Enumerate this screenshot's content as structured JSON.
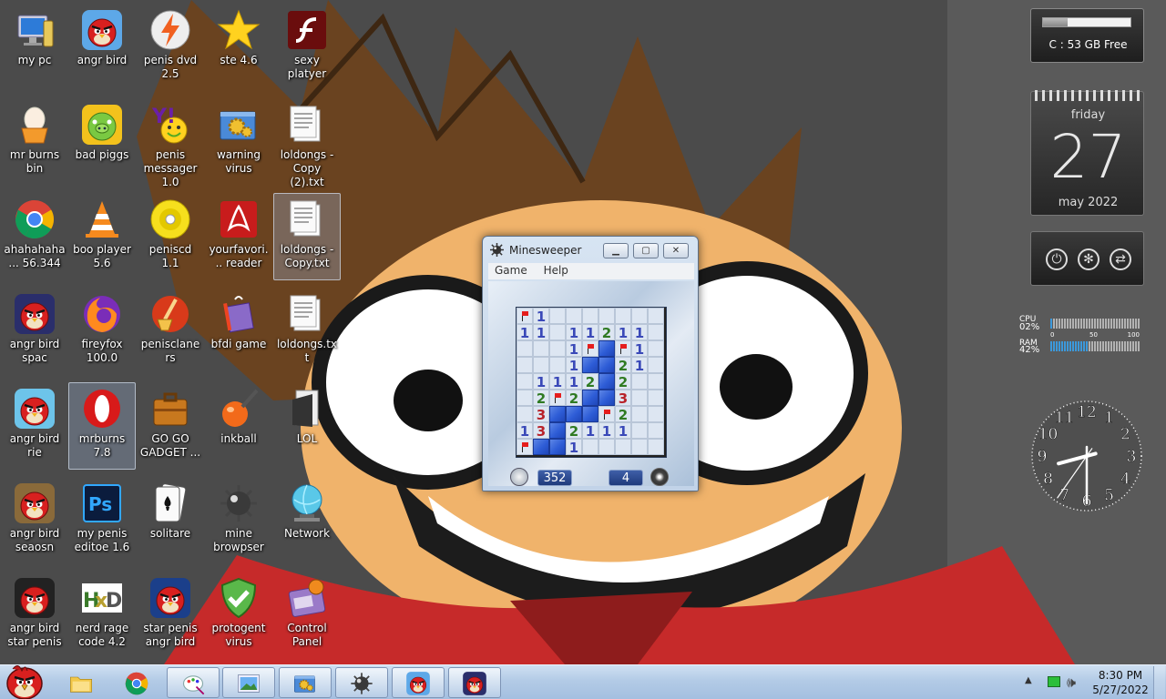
{
  "desktop": {
    "icons": [
      {
        "label": "my pc",
        "icon": "computer-icon"
      },
      {
        "label": "angr bird",
        "icon": "angry-bird-icon"
      },
      {
        "label": "penis dvd 2.5",
        "icon": "lightning-disc-icon"
      },
      {
        "label": "ste 4.6",
        "icon": "star-icon"
      },
      {
        "label": "sexy platyer",
        "icon": "flash-player-icon"
      },
      {
        "label": "mr burns bin",
        "icon": "egg-bin-icon"
      },
      {
        "label": "bad piggs",
        "icon": "bad-piggies-icon"
      },
      {
        "label": "penis messager 1.0",
        "icon": "yahoo-messenger-icon"
      },
      {
        "label": "warning virus",
        "icon": "gears-window-icon"
      },
      {
        "label": "loldongs - Copy (2).txt",
        "icon": "text-file-icon"
      },
      {
        "label": "ahahahaha... 56.344",
        "icon": "chrome-icon"
      },
      {
        "label": "boo player 5.6",
        "icon": "vlc-cone-icon"
      },
      {
        "label": "peniscd 1.1",
        "icon": "cd-icon"
      },
      {
        "label": "yourfavori... reader",
        "icon": "pdf-reader-icon"
      },
      {
        "label": "loldongs - Copy.txt",
        "icon": "text-file-icon"
      },
      {
        "label": "angr  bird spac",
        "icon": "angry-bird-space-icon"
      },
      {
        "label": "fireyfox 100.0",
        "icon": "firefox-icon"
      },
      {
        "label": "penisclaners",
        "icon": "broom-icon"
      },
      {
        "label": "bfdi game",
        "icon": "gift-box-icon"
      },
      {
        "label": "loldongs.txt",
        "icon": "text-file-icon"
      },
      {
        "label": "angr bird rie",
        "icon": "angry-bird-rio-icon"
      },
      {
        "label": "mrburns 7.8",
        "icon": "opera-icon"
      },
      {
        "label": "GO GO GADGET ...",
        "icon": "briefcase-icon"
      },
      {
        "label": "inkball",
        "icon": "inkball-icon"
      },
      {
        "label": "LOL",
        "icon": "book-icon"
      },
      {
        "label": "angr bird seaosn",
        "icon": "angry-bird-seasons-icon"
      },
      {
        "label": "my penis editoe 1.6",
        "icon": "photoshop-icon"
      },
      {
        "label": "solitare",
        "icon": "playing-card-icon"
      },
      {
        "label": "mine browpser",
        "icon": "mine-icon"
      },
      {
        "label": "Network",
        "icon": "network-globe-icon"
      },
      {
        "label": "angr bird star penis",
        "icon": "angry-bird-star-wars-icon"
      },
      {
        "label": "nerd rage code 4.2",
        "icon": "hxd-icon"
      },
      {
        "label": "star penis angr bird",
        "icon": "angry-bird-star-wars-2-icon"
      },
      {
        "label": "protogent virus",
        "icon": "shield-check-icon"
      },
      {
        "label": "Control Panel",
        "icon": "control-panel-icon"
      }
    ]
  },
  "minesweeper": {
    "title": "Minesweeper",
    "menu": [
      "Game",
      "Help"
    ],
    "timer": "352",
    "mines_left": "4",
    "grid": [
      [
        "F",
        "1",
        "o",
        "o",
        "o",
        "o",
        "o",
        "o",
        "o"
      ],
      [
        "1",
        "1",
        "o",
        "1",
        "1",
        "2",
        "1",
        "1",
        "o"
      ],
      [
        "o",
        "o",
        "o",
        "1",
        "F",
        "H",
        "F",
        "1",
        "o"
      ],
      [
        "o",
        "o",
        "o",
        "1",
        "H",
        "H",
        "2",
        "1",
        "o"
      ],
      [
        "o",
        "1",
        "1",
        "1",
        "2",
        "H",
        "2",
        "o",
        "o"
      ],
      [
        "o",
        "2",
        "F",
        "2",
        "H",
        "H",
        "3",
        "o",
        "o"
      ],
      [
        "o",
        "3",
        "H",
        "H",
        "H",
        "F",
        "2",
        "o",
        "o"
      ],
      [
        "1",
        "3",
        "H",
        "2",
        "1",
        "1",
        "1",
        "o",
        "o"
      ],
      [
        "F",
        "H",
        "H",
        "1",
        "o",
        "o",
        "o",
        "o",
        "o"
      ]
    ]
  },
  "gadgets": {
    "drive": {
      "label": "C : 53 GB Free",
      "used_fraction": 0.28
    },
    "calendar": {
      "day": "friday",
      "date": "27",
      "month": "may 2022"
    },
    "meter": {
      "cpu_label": "CPU",
      "cpu_value": "02%",
      "ram_label": "RAM",
      "ram_value": "42%",
      "cpu": 0.02,
      "ram": 0.42,
      "scale": [
        "0",
        "50",
        "100"
      ]
    },
    "clock": {
      "hour": 8,
      "minute": 30,
      "numbers": [
        "12",
        "1",
        "2",
        "3",
        "4",
        "5",
        "6",
        "7",
        "8",
        "9",
        "10",
        "11"
      ]
    }
  },
  "taskbar": {
    "buttons": [
      {
        "icon": "folder-icon",
        "state": "pinned"
      },
      {
        "icon": "chrome-icon",
        "state": "pinned"
      },
      {
        "icon": "paint-icon",
        "state": "running"
      },
      {
        "icon": "picture-viewer-icon",
        "state": "running"
      },
      {
        "icon": "gears-window-icon",
        "state": "running"
      },
      {
        "icon": "mine-icon",
        "state": "running"
      },
      {
        "icon": "angry-bird-icon",
        "state": "running"
      },
      {
        "icon": "angry-bird-space-icon",
        "state": "running"
      }
    ],
    "time": "8:30 PM",
    "date": "5/27/2022"
  },
  "colors": {
    "taskbar": "#b3cbe6",
    "board_hidden": "#2d5cd6",
    "board_open": "#dde6f2"
  }
}
